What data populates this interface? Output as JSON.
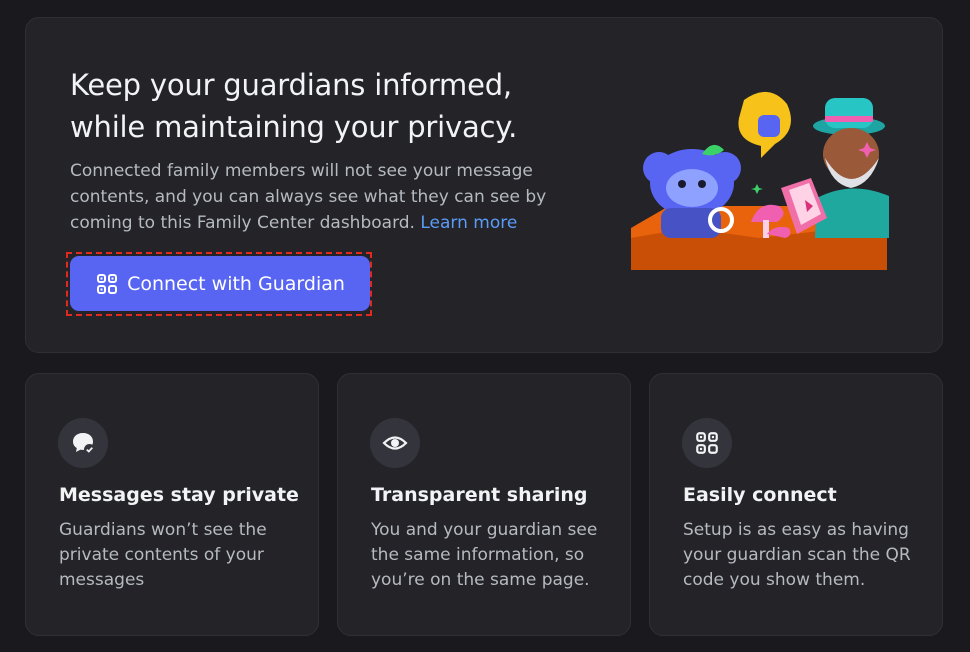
{
  "hero": {
    "title": "Keep your guardians informed, while maintaining your privacy.",
    "description": "Connected family members will not see your message contents, and you can always see what they can see by coming to this Family Center dashboard.",
    "learn_more": "Learn more",
    "button_label": "Connect with Guardian",
    "button_icon": "qr-code-icon",
    "illustration": "family-center-illustration"
  },
  "cards": [
    {
      "icon": "chat-bubble-check-icon",
      "title": "Messages stay private",
      "body": "Guardians won’t see the private contents of your messages"
    },
    {
      "icon": "eye-icon",
      "title": "Transparent sharing",
      "body": "You and your guardian see the same information, so you’re on the same page."
    },
    {
      "icon": "qr-code-icon",
      "title": "Easily connect",
      "body": "Setup is as easy as having your guardian scan the QR code you show them."
    }
  ],
  "colors": {
    "background": "#1a1a1e",
    "card": "#232328",
    "accent": "#5865f2",
    "link": "#5b9cf6",
    "highlight": "#e02a1f"
  }
}
